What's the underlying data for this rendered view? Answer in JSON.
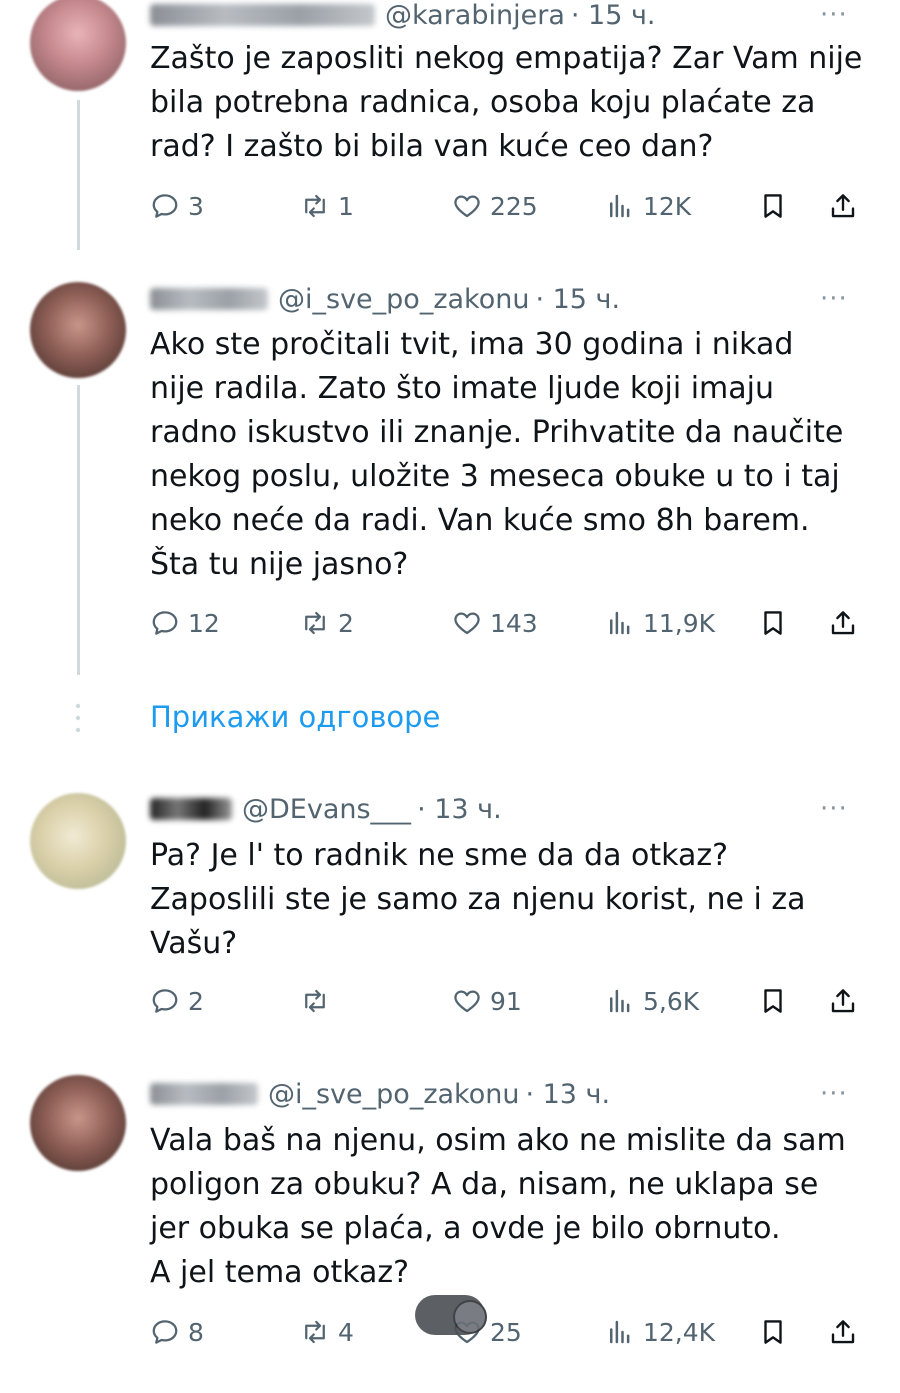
{
  "tweets": [
    {
      "handle": "@karabinjera",
      "time": "· 15 ч.",
      "text_lines": [
        "Zašto je zaposliti nekog empatija? Zar Vam nije",
        "bila potrebna radnica, osoba koju plaćate za",
        "rad? I zašto bi bila van kuće ceo dan?"
      ],
      "replies": "3",
      "retweets": "1",
      "likes": "225",
      "views": "12K"
    },
    {
      "handle": "@i_sve_po_zakonu",
      "time": "· 15 ч.",
      "text_lines": [
        "Ako ste pročitali tvit, ima 30 godina i nikad",
        "nije radila. Zato što imate ljude koji imaju",
        "radno iskustvo ili znanje. Prihvatite da naučite",
        "nekog poslu, uložite 3 meseca obuke u to i taj",
        "neko neće da radi. Van kuće smo 8h barem.",
        "Šta tu nije jasno?"
      ],
      "replies": "12",
      "retweets": "2",
      "likes": "143",
      "views": "11,9K"
    },
    {
      "handle": "@DEvans___",
      "time": "· 13 ч.",
      "text_lines": [
        "Pa? Je l' to radnik ne sme da da otkaz?",
        "Zaposlili ste je samo za njenu korist, ne i za",
        "Vašu?"
      ],
      "replies": "2",
      "retweets": "",
      "likes": "91",
      "views": "5,6K"
    },
    {
      "handle": "@i_sve_po_zakonu",
      "time": "· 13 ч.",
      "text_lines": [
        "Vala baš na njenu, osim ako ne mislite da sam",
        "poligon za obuku? A da, nisam, ne uklapa se",
        "jer obuka se plaća, a ovde je bilo obrnuto.",
        "A jel tema otkaz?"
      ],
      "replies": "8",
      "retweets": "4",
      "likes": "25",
      "views": "12,4K"
    }
  ],
  "show_replies_label": "Прикажи одговоре",
  "more_label": "···",
  "icons": {
    "reply": "reply-icon",
    "retweet": "retweet-icon",
    "like": "heart-icon",
    "views": "views-icon",
    "bookmark": "bookmark-icon",
    "share": "share-icon"
  },
  "colors": {
    "accent": "#1d9bf0",
    "muted": "#536471",
    "text": "#0f1419"
  }
}
